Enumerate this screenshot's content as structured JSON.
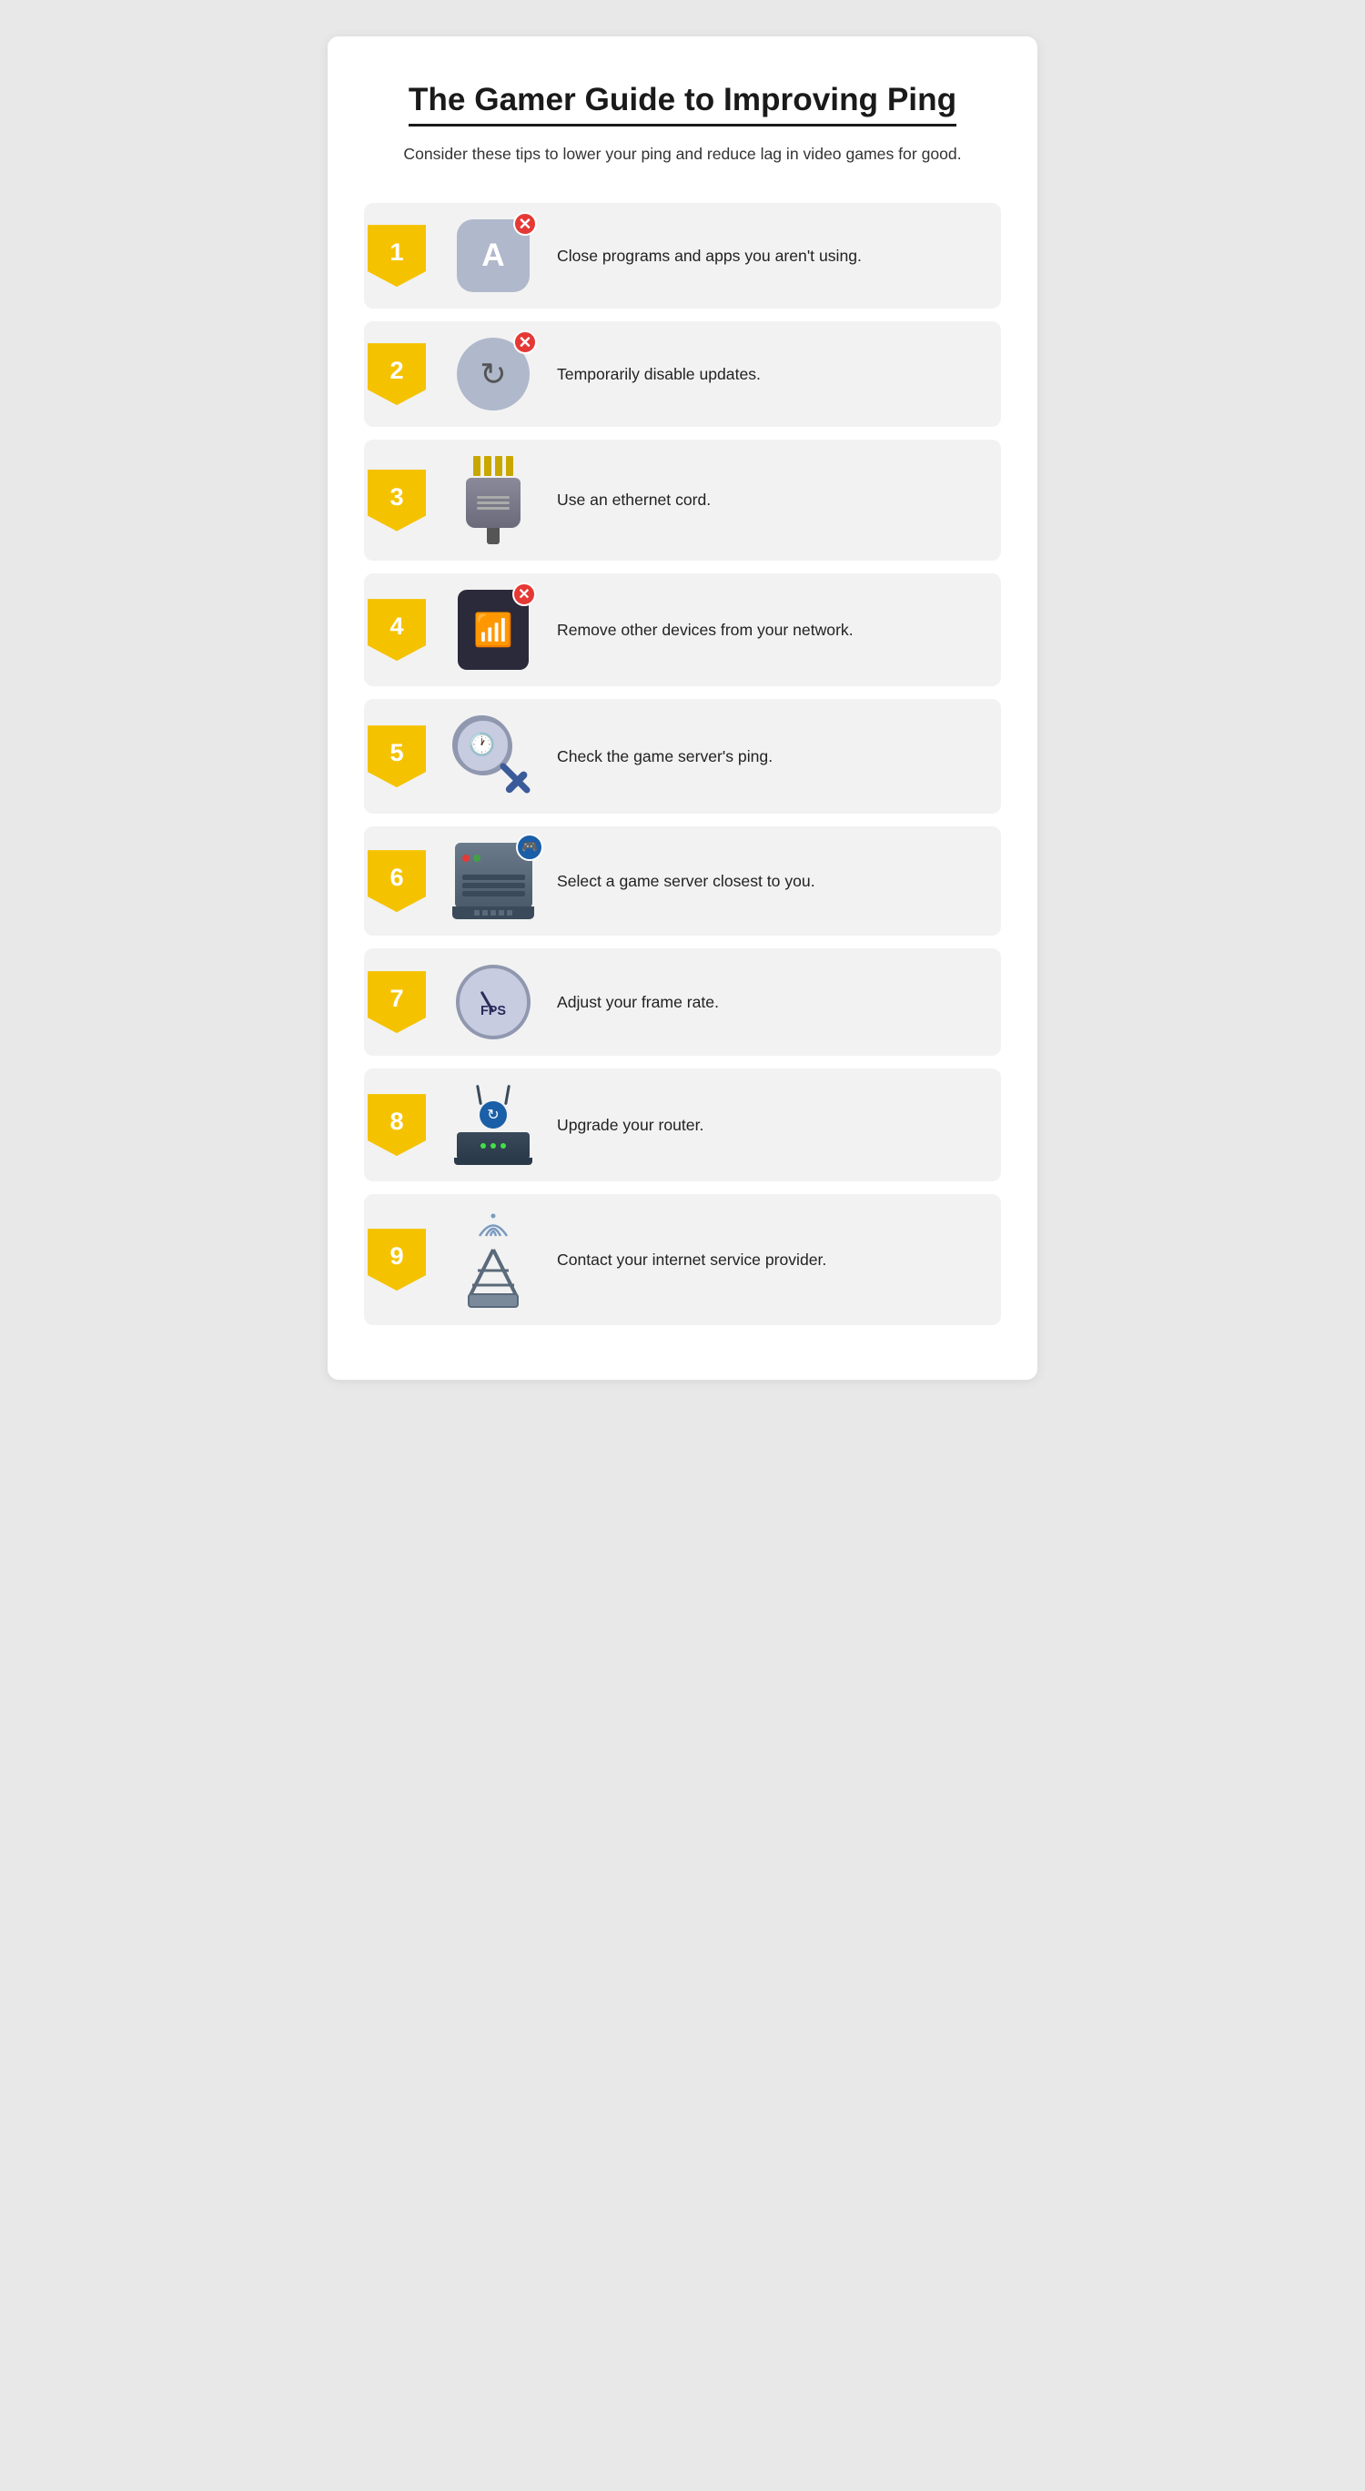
{
  "page": {
    "title": "The Gamer Guide to Improving Ping",
    "subtitle": "Consider these tips to lower your ping and reduce lag in video games for good.",
    "accent_color": "#f5c200",
    "items": [
      {
        "number": "1",
        "text": "Close programs and apps you aren't using.",
        "icon_name": "close-programs-icon"
      },
      {
        "number": "2",
        "text": "Temporarily disable updates.",
        "icon_name": "disable-updates-icon"
      },
      {
        "number": "3",
        "text": "Use an ethernet cord.",
        "icon_name": "ethernet-icon"
      },
      {
        "number": "4",
        "text": "Remove other devices from your network.",
        "icon_name": "remove-devices-icon"
      },
      {
        "number": "5",
        "text": "Check the game server's ping.",
        "icon_name": "check-ping-icon"
      },
      {
        "number": "6",
        "text": "Select a game server closest to you.",
        "icon_name": "game-server-icon"
      },
      {
        "number": "7",
        "text": "Adjust your frame rate.",
        "icon_name": "frame-rate-icon"
      },
      {
        "number": "8",
        "text": "Upgrade your router.",
        "icon_name": "router-icon"
      },
      {
        "number": "9",
        "text": "Contact your internet service provider.",
        "icon_name": "isp-icon"
      }
    ]
  }
}
